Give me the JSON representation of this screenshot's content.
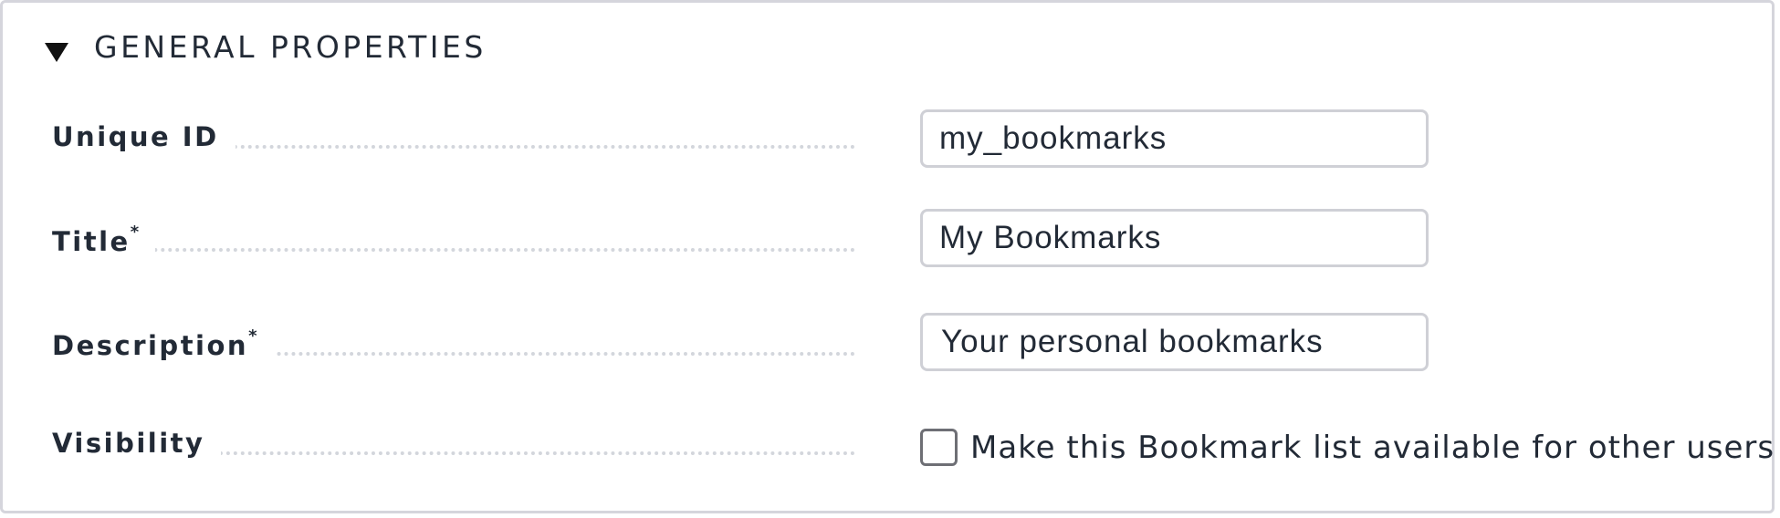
{
  "section": {
    "title": "GENERAL PROPERTIES",
    "toggle_icon": "triangle-down-icon"
  },
  "fields": {
    "unique_id": {
      "label": "Unique ID",
      "value": "my_bookmarks"
    },
    "title": {
      "label": "Title",
      "required_mark": "*",
      "value": "My Bookmarks"
    },
    "description": {
      "label": "Description",
      "required_mark": "*",
      "value": "Your personal bookmarks"
    },
    "visibility": {
      "label": "Visibility",
      "checkbox_label": "Make this Bookmark list available for other users",
      "checked": false
    }
  },
  "colors": {
    "text": "#222a36",
    "border": "#d5d5dc",
    "input_border": "#cfd0d6",
    "dots": "#d3d6dc",
    "checkbox_border": "#6e6f75"
  }
}
